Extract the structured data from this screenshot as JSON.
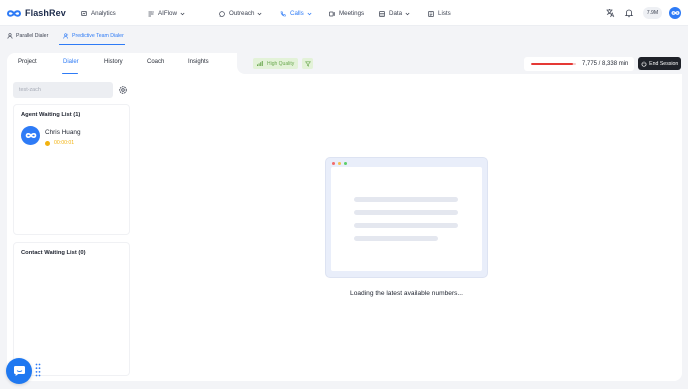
{
  "app": {
    "name": "FlashRev"
  },
  "topnav": {
    "items": [
      {
        "label": "Analytics",
        "icon": "analytics-icon"
      },
      {
        "label": "AIFlow",
        "icon": "aiflow-icon"
      },
      {
        "label": "Outreach",
        "icon": "outreach-icon"
      },
      {
        "label": "Calls",
        "icon": "phone-icon",
        "active": true
      },
      {
        "label": "Meetings",
        "icon": "meetings-icon"
      },
      {
        "label": "Data",
        "icon": "data-icon"
      },
      {
        "label": "Lists",
        "icon": "lists-icon"
      }
    ],
    "credits": "7.9M"
  },
  "subnav": {
    "items": [
      {
        "label": "Parallel Dialer"
      },
      {
        "label": "Predictive Team Dialer",
        "active": true
      }
    ]
  },
  "tabs": [
    {
      "label": "Project"
    },
    {
      "label": "Dialer",
      "active": true
    },
    {
      "label": "History"
    },
    {
      "label": "Coach"
    },
    {
      "label": "Insights"
    }
  ],
  "quality": {
    "label": "High Quality"
  },
  "usage": {
    "text": "7,775 / 8,338 min",
    "used": 7775,
    "total": 8338
  },
  "end_session": {
    "label": "End Session"
  },
  "search": {
    "placeholder": "test-zach"
  },
  "agent_list": {
    "title": "Agent Waiting List (1)",
    "agents": [
      {
        "name": "Chris Huang",
        "timer": "00:00:01"
      }
    ]
  },
  "contact_list": {
    "title": "Contact Waiting List (0)"
  },
  "main": {
    "loading_text": "Loading the latest available numbers..."
  },
  "colors": {
    "accent": "#2e7bf6",
    "danger": "#e53935",
    "quality": "#6aa84f",
    "waiting": "#f2b20f"
  }
}
